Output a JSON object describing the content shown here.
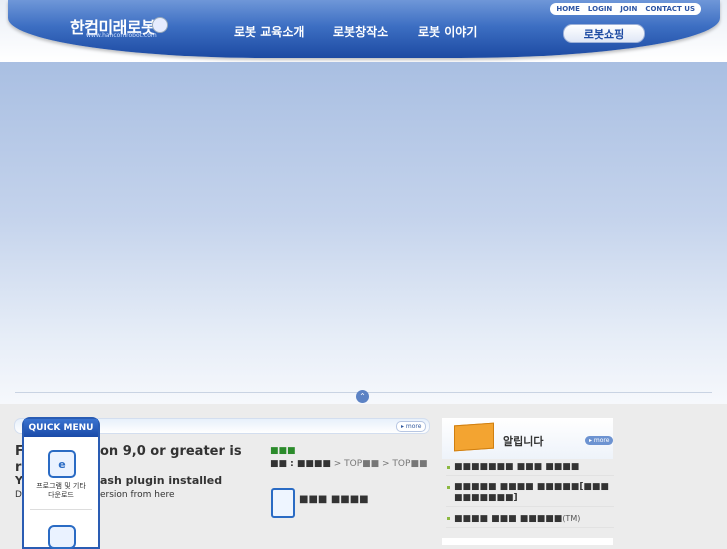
{
  "header": {
    "logo_text": "한컴미래로봇",
    "logo_sub": "www.hancomrobot.com",
    "nav": [
      "로봇 교육소개",
      "로봇창작소",
      "로봇 이야기"
    ],
    "top_links": [
      "HOME",
      "LOGIN",
      "JOIN",
      "CONTACT US"
    ],
    "shop_label": "로봇쇼핑"
  },
  "main": {
    "more_label": "▸ more",
    "flash_line1": "Flash version 9,0 or greater is",
    "flash_line1_visible": "F",
    "flash_line1_tail": "on 9,0 or greater is",
    "flash_line2_visible": "r",
    "flash_line3_visible": "Y",
    "flash_line3_tail": "ash plugin installed",
    "flash_line4_visible": "D",
    "flash_line4_tail": "ersion from here"
  },
  "quick_menu": {
    "title": "QUICK MENU",
    "item1_label_1": "프로그램 및 기타",
    "item1_label_2": "다운로드"
  },
  "column2": {
    "dots": "■■■",
    "path": "■■ : ■■■■",
    "path_tail1": " > TOP■■",
    "path_tail2": " > TOP■■",
    "title": "■■■ ■■■■"
  },
  "notice": {
    "title": "알립니다",
    "more_label": "▸ more",
    "items": [
      {
        "text": "■■■■■■■ ■■■ ■■■■",
        "suffix": ""
      },
      {
        "text": "■■■■■ ■■■■ ■■■■■[■■■ ■■■■■■■]",
        "suffix": ""
      },
      {
        "text": "■■■■ ■■■ ■■■■■",
        "suffix": "(TM)"
      }
    ]
  }
}
